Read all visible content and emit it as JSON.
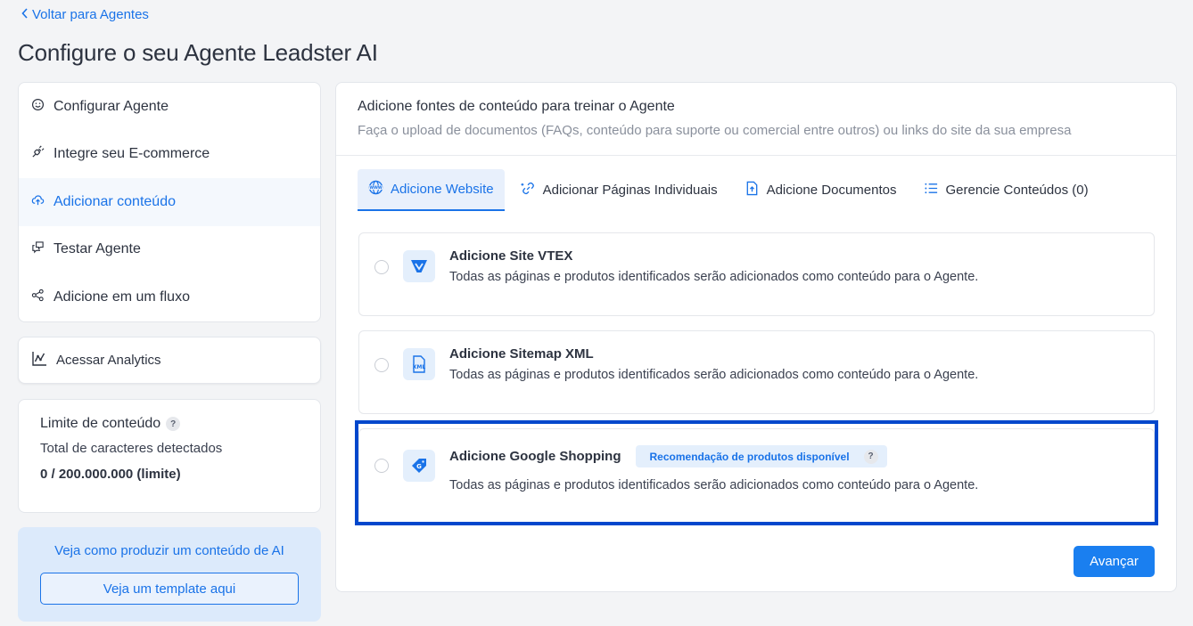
{
  "header": {
    "back_label": "Voltar para Agentes",
    "title": "Configure o seu Agente Leadster AI"
  },
  "sidebar": {
    "items": [
      {
        "label": "Configurar Agente",
        "icon": "smile-icon"
      },
      {
        "label": "Integre seu E-commerce",
        "icon": "plug-icon"
      },
      {
        "label": "Adicionar conteúdo",
        "icon": "cloud-upload-icon",
        "active": true
      },
      {
        "label": "Testar Agente",
        "icon": "chat-icon"
      },
      {
        "label": "Adicione em um fluxo",
        "icon": "share-nodes-icon"
      }
    ],
    "analytics_label": "Acessar Analytics",
    "limit": {
      "title": "Limite de conteúdo",
      "help": "?",
      "subtitle": "Total de caracteres detectados",
      "value": "0 / 200.000.000 (limite)"
    },
    "promo": {
      "text": "Veja como produzir um conteúdo de AI",
      "button_label": "Veja um template aqui"
    }
  },
  "main": {
    "title": "Adicione fontes de conteúdo para treinar o Agente",
    "description": "Faça o upload de documentos (FAQs, conteúdo para suporte ou comercial entre outros) ou links do site da sua empresa",
    "tabs": [
      {
        "label": "Adicione Website",
        "icon": "globe-www-icon",
        "active": true
      },
      {
        "label": "Adicionar Páginas Individuais",
        "icon": "link-add-icon"
      },
      {
        "label": "Adicione Documentos",
        "icon": "file-upload-icon"
      },
      {
        "label": "Gerencie Conteúdos (0)",
        "icon": "list-icon"
      }
    ],
    "options": [
      {
        "title": "Adicione Site VTEX",
        "description": "Todas as páginas e produtos identificados serão adicionados como conteúdo para o Agente.",
        "icon": "vtex-icon"
      },
      {
        "title": "Adicione Sitemap XML",
        "description": "Todas as páginas e produtos identificados serão adicionados como conteúdo para o Agente.",
        "icon": "xml-file-icon"
      },
      {
        "title": "Adicione Google Shopping",
        "badge": "Recomendação de produtos disponível",
        "badge_help": "?",
        "description": "Todas as páginas e produtos identificados serão adicionados como conteúdo para o Agente.",
        "icon": "google-tag-icon"
      }
    ],
    "next_label": "Avançar"
  },
  "colors": {
    "accent": "#1a73e8",
    "highlight": "#0047cc",
    "background": "#f3f4f6"
  }
}
